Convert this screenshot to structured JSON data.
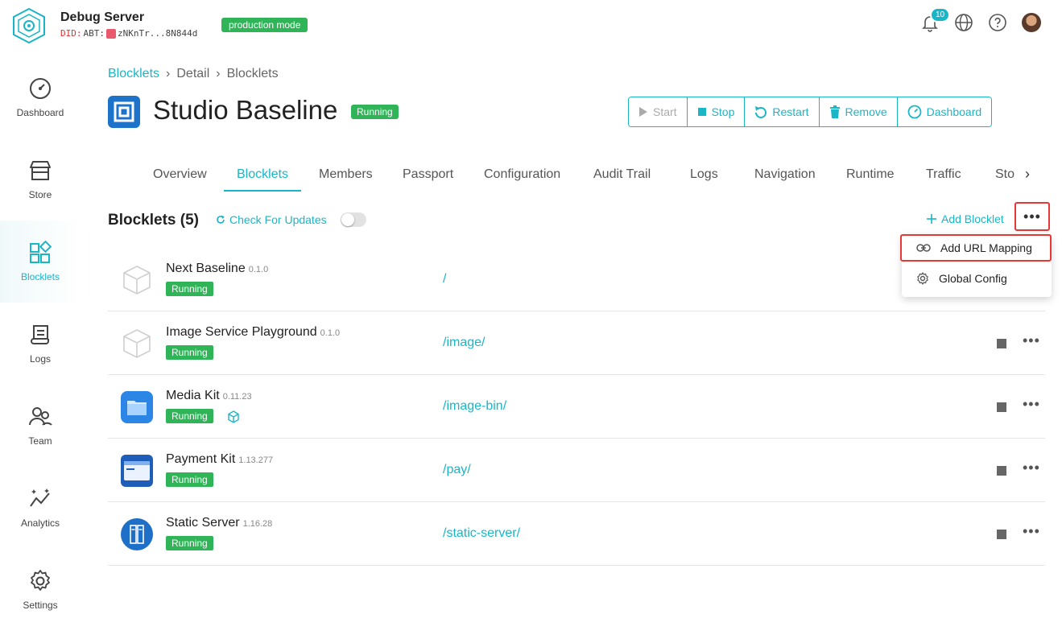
{
  "header": {
    "server_name": "Debug Server",
    "did_prefix": "DID:",
    "did_scheme": "ABT:",
    "did_value": "zNKnTr...8N844d",
    "mode": "production mode",
    "notification_count": "10"
  },
  "sidebar": {
    "items": [
      {
        "label": "Dashboard",
        "icon": "gauge-icon"
      },
      {
        "label": "Store",
        "icon": "store-icon"
      },
      {
        "label": "Blocklets",
        "icon": "blocks-icon"
      },
      {
        "label": "Logs",
        "icon": "scroll-icon"
      },
      {
        "label": "Team",
        "icon": "users-icon"
      },
      {
        "label": "Analytics",
        "icon": "sparkline-icon"
      },
      {
        "label": "Settings",
        "icon": "gear-icon"
      }
    ],
    "active": "Blocklets"
  },
  "breadcrumb": {
    "items": [
      "Blocklets",
      "Detail",
      "Blocklets"
    ],
    "sep": "›"
  },
  "app": {
    "title": "Studio Baseline",
    "status": "Running"
  },
  "actions": {
    "start": "Start",
    "stop": "Stop",
    "restart": "Restart",
    "remove": "Remove",
    "dashboard": "Dashboard"
  },
  "tabs": {
    "items": [
      "Overview",
      "Blocklets",
      "Members",
      "Passport",
      "Configuration",
      "Audit Trail",
      "Logs",
      "Navigation",
      "Runtime",
      "Traffic",
      "Sto"
    ],
    "active": "Blocklets",
    "arrow": "›"
  },
  "section": {
    "title": "Blocklets (5)",
    "check_updates": "Check For Updates",
    "add_blocklet": "Add Blocklet",
    "more": "•••"
  },
  "menu": {
    "items": [
      {
        "label": "Add URL Mapping",
        "icon": "link-icon"
      },
      {
        "label": "Global Config",
        "icon": "gear-icon"
      }
    ]
  },
  "blocklets": [
    {
      "name": "Next Baseline",
      "version": "0.1.0",
      "status": "Running",
      "path": "/",
      "icon": "cube-icon"
    },
    {
      "name": "Image Service Playground",
      "version": "0.1.0",
      "status": "Running",
      "path": "/image/",
      "icon": "cube-icon"
    },
    {
      "name": "Media Kit",
      "version": "0.11.23",
      "status": "Running",
      "path": "/image-bin/",
      "icon": "folder-icon"
    },
    {
      "name": "Payment Kit",
      "version": "1.13.277",
      "status": "Running",
      "path": "/pay/",
      "icon": "payment-icon"
    },
    {
      "name": "Static Server",
      "version": "1.16.28",
      "status": "Running",
      "path": "/static-server/",
      "icon": "server-icon"
    }
  ],
  "colors": {
    "accent": "#19b6c7",
    "success": "#2fb458",
    "highlight": "#e53935"
  }
}
